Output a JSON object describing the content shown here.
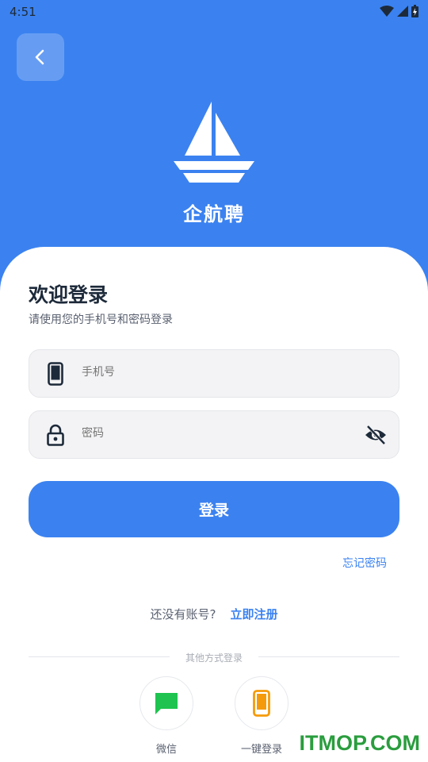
{
  "status": {
    "time": "4:51"
  },
  "app": {
    "name": "企航聘"
  },
  "login": {
    "title": "欢迎登录",
    "subtitle": "请使用您的手机号和密码登录",
    "phone_placeholder": "手机号",
    "password_placeholder": "密码",
    "login_button": "登录",
    "forgot_password": "忘记密码",
    "no_account": "还没有账号?",
    "register_link": "立即注册",
    "other_methods": "其他方式登录"
  },
  "alt_logins": [
    {
      "label": "微信",
      "icon": "chat-bubble-icon",
      "color": "#1ec44f"
    },
    {
      "label": "一键登录",
      "icon": "phone-icon",
      "color": "#f59b0b"
    }
  ],
  "watermark": "ITMOP.COM",
  "colors": {
    "primary": "#3b82f0",
    "text": "#1d2a3a"
  }
}
